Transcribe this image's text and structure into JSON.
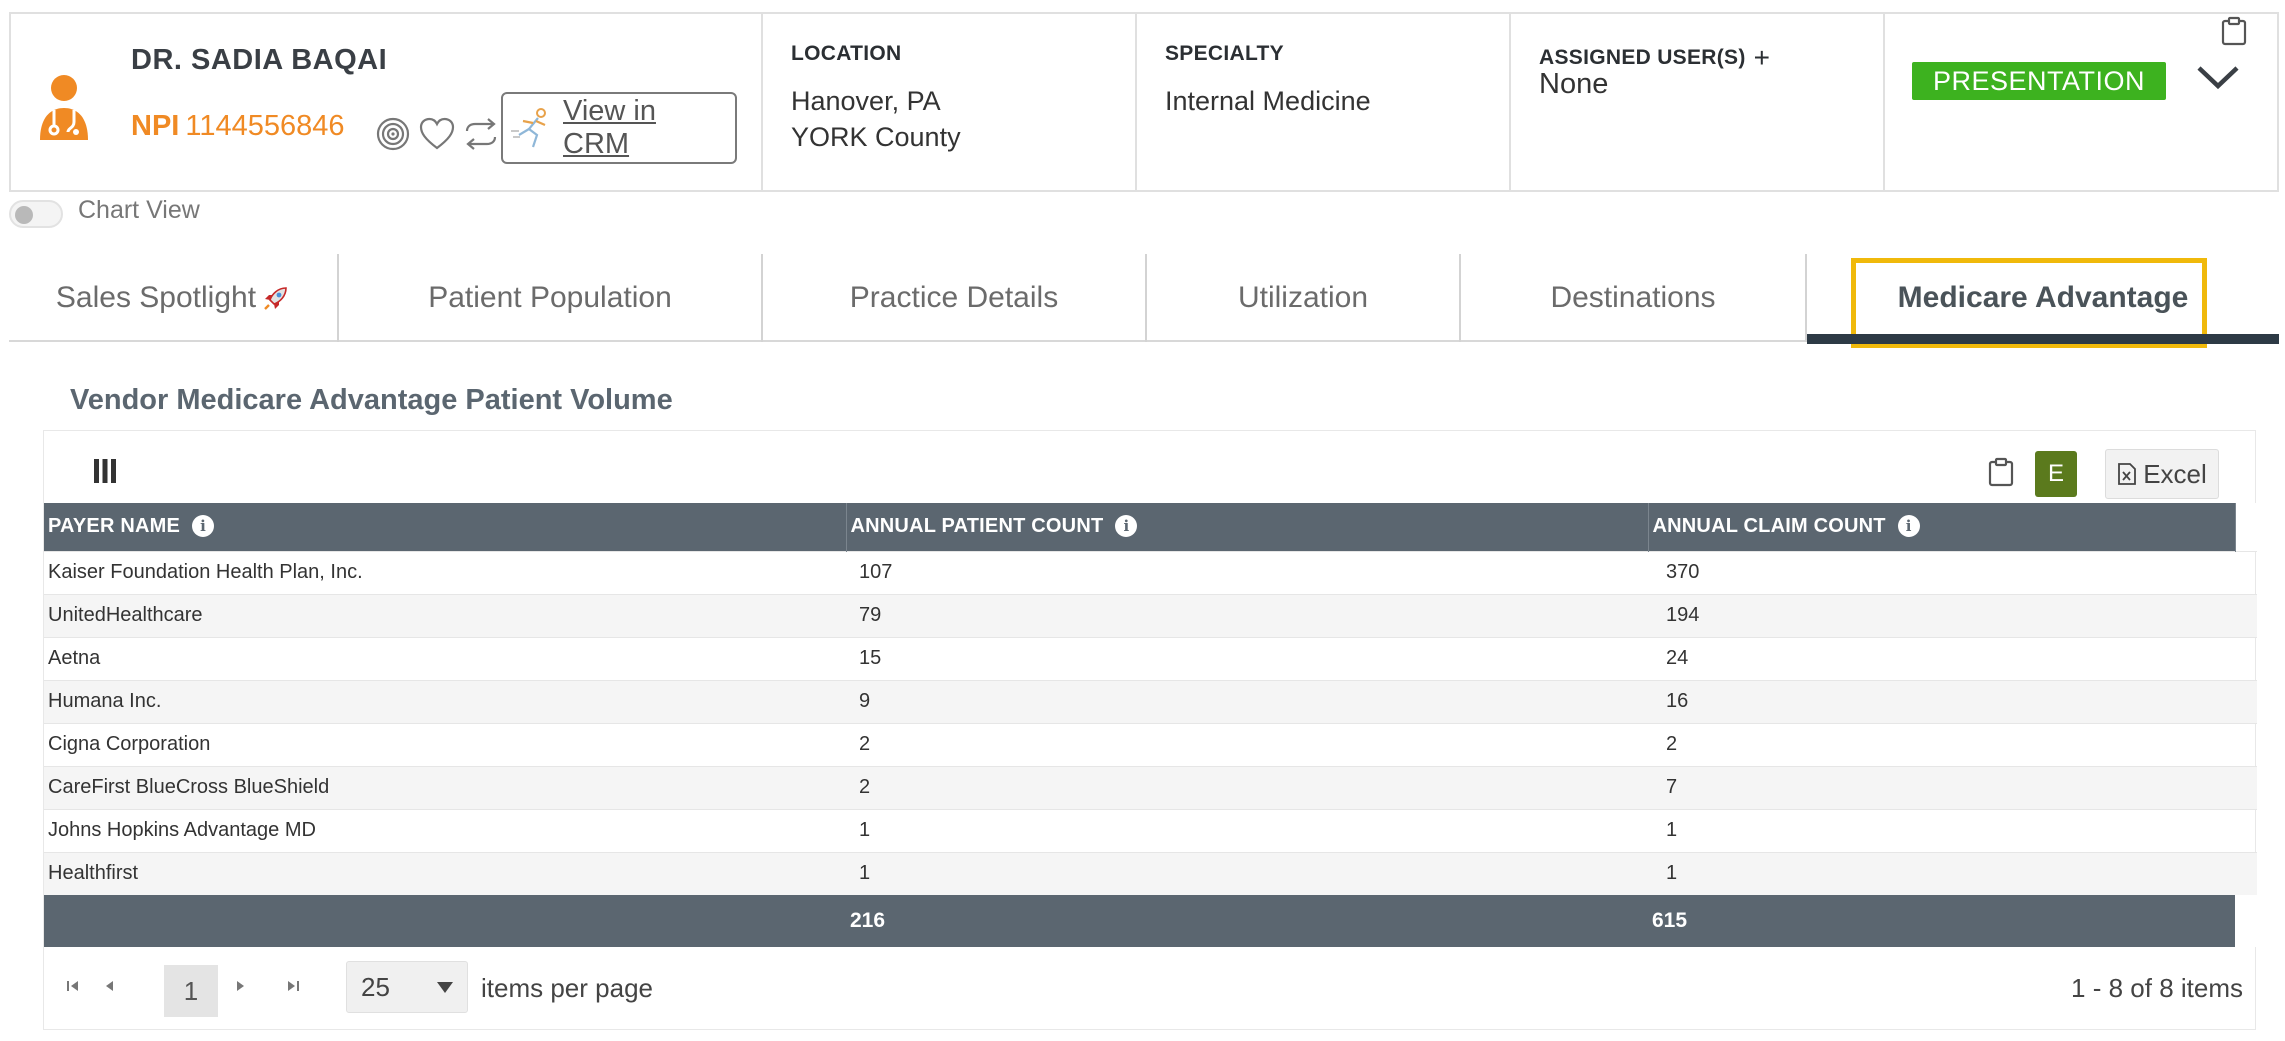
{
  "provider": {
    "name": "DR. SADIA BAQAI",
    "npi_label": "NPI",
    "npi_value": "1144556846",
    "crm_button": "View in CRM",
    "icon": "doctor-icon",
    "accent_color": "#f08a24"
  },
  "location": {
    "label": "LOCATION",
    "line1": "Hanover, PA",
    "line2": "YORK County"
  },
  "specialty": {
    "label": "SPECIALTY",
    "value": "Internal Medicine"
  },
  "assigned": {
    "label": "ASSIGNED USER(S)",
    "plus": "+",
    "value": "None"
  },
  "status": {
    "badge": "PRESENTATION",
    "badge_color": "#3db21f"
  },
  "chart_view": {
    "label": "Chart View",
    "enabled": false
  },
  "tabs": [
    {
      "label": "Sales Spotlight"
    },
    {
      "label": "Patient Population"
    },
    {
      "label": "Practice Details"
    },
    {
      "label": "Utilization"
    },
    {
      "label": "Destinations"
    },
    {
      "label": "Medicare Advantage",
      "active": true
    }
  ],
  "section": {
    "title": "Vendor Medicare Advantage Patient Volume"
  },
  "grid": {
    "e_button": "E",
    "excel_button": "Excel",
    "columns": [
      "PAYER NAME",
      "ANNUAL PATIENT COUNT",
      "ANNUAL CLAIM COUNT"
    ],
    "rows": [
      [
        "Kaiser Foundation Health Plan, Inc.",
        "107",
        "370"
      ],
      [
        "UnitedHealthcare",
        "79",
        "194"
      ],
      [
        "Aetna",
        "15",
        "24"
      ],
      [
        "Humana Inc.",
        "9",
        "16"
      ],
      [
        "Cigna Corporation",
        "2",
        "2"
      ],
      [
        "CareFirst BlueCross BlueShield",
        "2",
        "7"
      ],
      [
        "Johns Hopkins Advantage MD",
        "1",
        "1"
      ],
      [
        "Healthfirst",
        "1",
        "1"
      ]
    ],
    "totals": [
      "",
      "216",
      "615"
    ],
    "header_color": "#5b6670"
  },
  "pager": {
    "current_page": "1",
    "page_size": "25",
    "items_per_page_label": "items per page",
    "summary": "1 - 8 of 8 items"
  }
}
